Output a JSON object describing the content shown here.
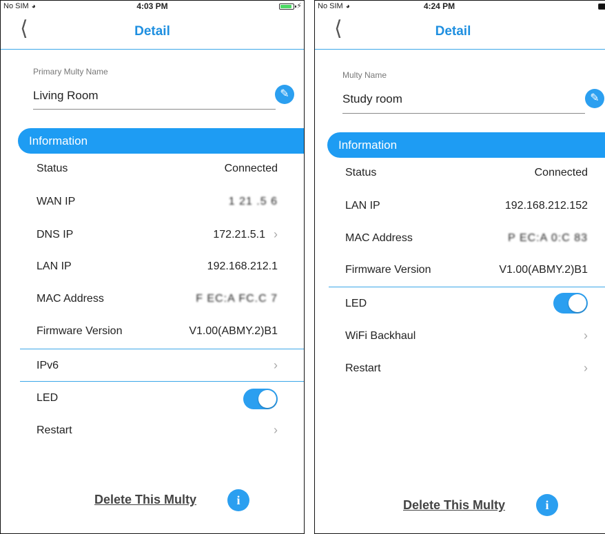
{
  "left": {
    "status_bar": {
      "carrier": "No SIM",
      "time": "4:03 PM"
    },
    "nav": {
      "back_icon": "chevron-left",
      "title": "Detail"
    },
    "name": {
      "label": "Primary Multy Name",
      "value": "Living Room",
      "edit_icon": "edit-icon"
    },
    "section_title": "Information",
    "rows": [
      {
        "label": "Status",
        "value": "Connected"
      },
      {
        "label": "WAN IP",
        "value": "1  21 .5  6"
      },
      {
        "label": "DNS IP",
        "value": "172.21.5.1"
      },
      {
        "label": "LAN IP",
        "value": "192.168.212.1"
      },
      {
        "label": "MAC Address",
        "value": "F  EC:A  FC.C  7"
      },
      {
        "label": "Firmware Version",
        "value": "V1.00(ABMY.2)B1"
      }
    ],
    "ipv6_label": "IPv6",
    "led_label": "LED",
    "led_on": true,
    "restart_label": "Restart",
    "delete_label": "Delete This Multy",
    "info_icon": "i"
  },
  "right": {
    "status_bar": {
      "carrier": "No SIM",
      "time": "4:24 PM"
    },
    "nav": {
      "back_icon": "chevron-left",
      "title": "Detail"
    },
    "name": {
      "label": "Multy Name",
      "value": "Study room",
      "edit_icon": "edit-icon"
    },
    "section_title": "Information",
    "rows": [
      {
        "label": "Status",
        "value": "Connected"
      },
      {
        "label": "LAN IP",
        "value": "192.168.212.152"
      },
      {
        "label": "MAC Address",
        "value": "P  EC:A  0:C  83"
      },
      {
        "label": "Firmware Version",
        "value": "V1.00(ABMY.2)B1"
      }
    ],
    "led_label": "LED",
    "led_on": true,
    "wifi_backhaul_label": "WiFi Backhaul",
    "restart_label": "Restart",
    "delete_label": "Delete This Multy",
    "info_icon": "i"
  },
  "colors": {
    "accent": "#1e9cf3",
    "title": "#1e8fe0",
    "battery_left": "#4cd964",
    "battery_right": "#111111"
  }
}
